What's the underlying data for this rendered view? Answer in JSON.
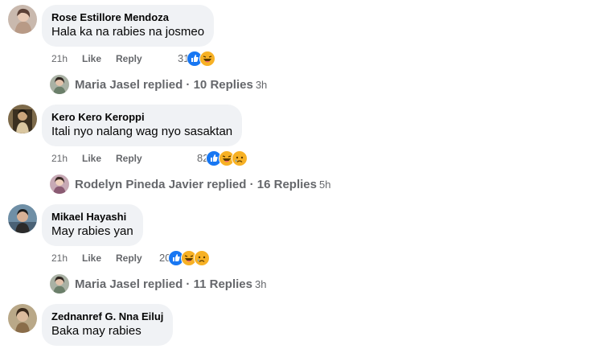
{
  "comments": [
    {
      "author": "Rose Estillore Mendoza",
      "text": "Hala ka na rabies na josmeo",
      "time": "21h",
      "like_label": "Like",
      "reply_label": "Reply",
      "reaction_count": "31",
      "reactions": [
        "like-reaction-icon",
        "haha-reaction-icon"
      ],
      "replies_summary": {
        "replier": "Maria Jasel replied",
        "separator": " · ",
        "count_text": "10 Replies",
        "time": "3h"
      }
    },
    {
      "author": "Kero Kero Keroppi",
      "text": "Itali nyo nalang wag nyo sasaktan",
      "time": "21h",
      "like_label": "Like",
      "reply_label": "Reply",
      "reaction_count": "82",
      "reactions": [
        "like-reaction-icon",
        "haha-reaction-icon",
        "sad-reaction-icon"
      ],
      "replies_summary": {
        "replier": "Rodelyn Pineda Javier replied",
        "separator": " · ",
        "count_text": "16 Replies",
        "time": "5h"
      }
    },
    {
      "author": "Mikael Hayashi",
      "text": "May rabies yan",
      "time": "21h",
      "like_label": "Like",
      "reply_label": "Reply",
      "reaction_count": "20",
      "reactions": [
        "like-reaction-icon",
        "haha-reaction-icon",
        "sad-reaction-icon"
      ],
      "replies_summary": {
        "replier": "Maria Jasel replied",
        "separator": " · ",
        "count_text": "11 Replies",
        "time": "3h"
      }
    },
    {
      "author": "Zednanref G. Nna Eiluj",
      "text": "Baka may rabies"
    }
  ],
  "colors": {
    "bubble_bg": "#f0f2f5",
    "meta_text": "#65676b",
    "like_blue": "#1877f2",
    "emoji_yellow": "#f7b125"
  }
}
